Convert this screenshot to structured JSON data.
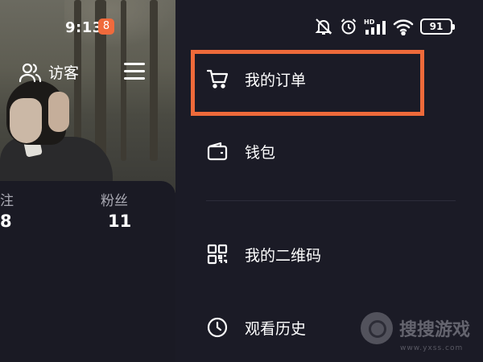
{
  "status_bar": {
    "time": "9:13",
    "app_badge": "8",
    "battery": "91",
    "network": "HD"
  },
  "profile": {
    "visitor_label": "访客",
    "stats": [
      {
        "label": "注",
        "value": "8"
      },
      {
        "label": "粉丝",
        "value": "11"
      }
    ]
  },
  "drawer": {
    "menu_items": [
      {
        "label": "我的订单",
        "icon": "cart-icon"
      },
      {
        "label": "钱包",
        "icon": "wallet-icon"
      },
      {
        "label": "我的二维码",
        "icon": "qrcode-icon"
      },
      {
        "label": "观看历史",
        "icon": "clock-icon"
      }
    ]
  },
  "watermark": {
    "text": "搜搜游戏",
    "url": "www.yxss.com"
  },
  "colors": {
    "background": "#1b1b26",
    "highlight": "#ee6a3a",
    "app_badge": "#f06a3c"
  }
}
